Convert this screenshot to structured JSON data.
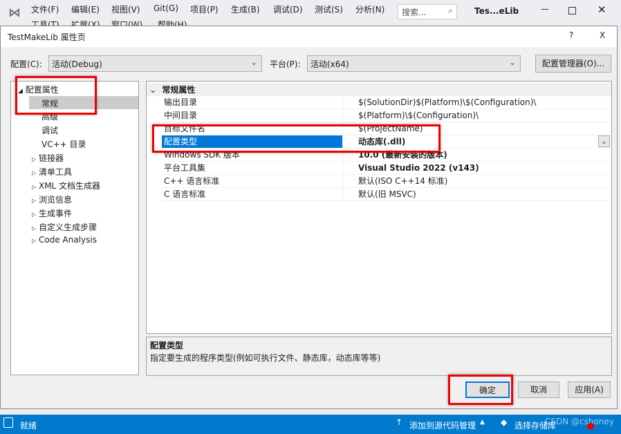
{
  "ide": {
    "menu": [
      "文件(F)",
      "编辑(E)",
      "视图(V)",
      "Git(G)",
      "项目(P)",
      "生成(B)",
      "调试(D)",
      "测试(S)",
      "分析(N)",
      "工具(T)",
      "扩展(X)",
      "窗口(W)",
      "帮助(H)"
    ],
    "search_placeholder": "搜索...",
    "title": "Tes...eLib"
  },
  "dialog": {
    "title": "TestMakeLib 属性页",
    "help": "?",
    "close": "X",
    "config_label": "配置(C):",
    "config_value": "活动(Debug)",
    "platform_label": "平台(P):",
    "platform_value": "活动(x64)",
    "config_manager": "配置管理器(O)...",
    "tree": [
      {
        "label": "配置属性",
        "expanded": true
      },
      {
        "label": "常规",
        "selected": true
      },
      {
        "label": "高级"
      },
      {
        "label": "调试"
      },
      {
        "label": "VC++ 目录"
      },
      {
        "label": "链接器"
      },
      {
        "label": "清单工具"
      },
      {
        "label": "XML 文档生成器"
      },
      {
        "label": "浏览信息"
      },
      {
        "label": "生成事件"
      },
      {
        "label": "自定义生成步骤"
      },
      {
        "label": "Code Analysis"
      }
    ],
    "section": "常规属性",
    "rows": [
      {
        "label": "输出目录",
        "value": "$(SolutionDir)$(Platform)\\$(Configuration)\\"
      },
      {
        "label": "中间目录",
        "value": "$(Platform)\\$(Configuration)\\"
      },
      {
        "label": "目标文件名",
        "value": "$(ProjectName)"
      },
      {
        "label": "配置类型",
        "value": "动态库(.dll)",
        "bold": true,
        "selected": true
      },
      {
        "label": "Windows SDK 版本",
        "value": "10.0 (最新安装的版本)",
        "bold": true
      },
      {
        "label": "平台工具集",
        "value": "Visual Studio 2022 (v143)",
        "bold": true
      },
      {
        "label": "C++ 语言标准",
        "value": "默认(ISO C++14 标准)"
      },
      {
        "label": "C 语言标准",
        "value": "默认(旧 MSVC)"
      }
    ],
    "desc_title": "配置类型",
    "desc_text": "指定要生成的程序类型(例如可执行文件、静态库，动态库等等)",
    "ok": "确定",
    "cancel": "取消",
    "apply": "应用(A)"
  },
  "status": {
    "ready": "就绪",
    "add_source": "添加到源代码管理",
    "select_repo": "选择存储库",
    "watermark": "CSDN @cshoney",
    "accent": "#007acc"
  }
}
